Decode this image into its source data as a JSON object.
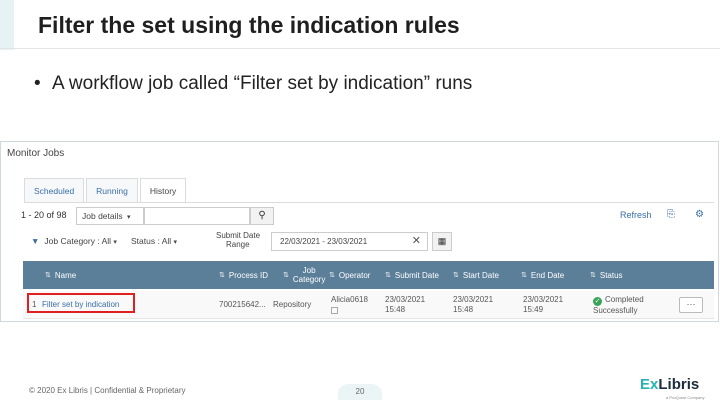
{
  "slide": {
    "title": "Filter the set using the indication rules",
    "bullet": "A workflow job called “Filter set by indication” runs",
    "footer": "© 2020 Ex Libris | Confidential & Proprietary",
    "page_number": "20",
    "logo_ex": "Ex",
    "logo_libris": "Libris",
    "logo_sub": "a ProQuest Company"
  },
  "monitor": {
    "title": "Monitor Jobs",
    "tabs": [
      {
        "label": "Scheduled"
      },
      {
        "label": "Running"
      },
      {
        "label": "History"
      }
    ],
    "pager": "1 - 20 of 98",
    "search_scope": "Job details",
    "refresh": "Refresh",
    "filters": {
      "job_category": "Job Category : All",
      "status": "Status : All",
      "submit_date_label_1": "Submit Date",
      "submit_date_label_2": "Range",
      "date_range": "22/03/2021 - 23/03/2021"
    },
    "columns": {
      "name": "Name",
      "process_id": "Process ID",
      "job_category_1": "Job",
      "job_category_2": "Category",
      "operator": "Operator",
      "submit_date": "Submit Date",
      "start_date": "Start Date",
      "end_date": "End Date",
      "status": "Status"
    },
    "rows": [
      {
        "num": "1",
        "name": "Filter set by indication",
        "process_id": "700215642...",
        "job_category": "Repository",
        "operator": "Alicia0618",
        "submit_date": "23/03/2021",
        "submit_time": "15:48",
        "start_date": "23/03/2021",
        "start_time": "15:48",
        "end_date": "23/03/2021",
        "end_time": "15:49",
        "status_1": "Completed",
        "status_2": "Successfully",
        "more": "···"
      }
    ]
  },
  "colors": {
    "header_bg": "#5b7f99",
    "link": "#3a6fa8",
    "highlight": "#e02020",
    "success": "#3aa35b"
  }
}
